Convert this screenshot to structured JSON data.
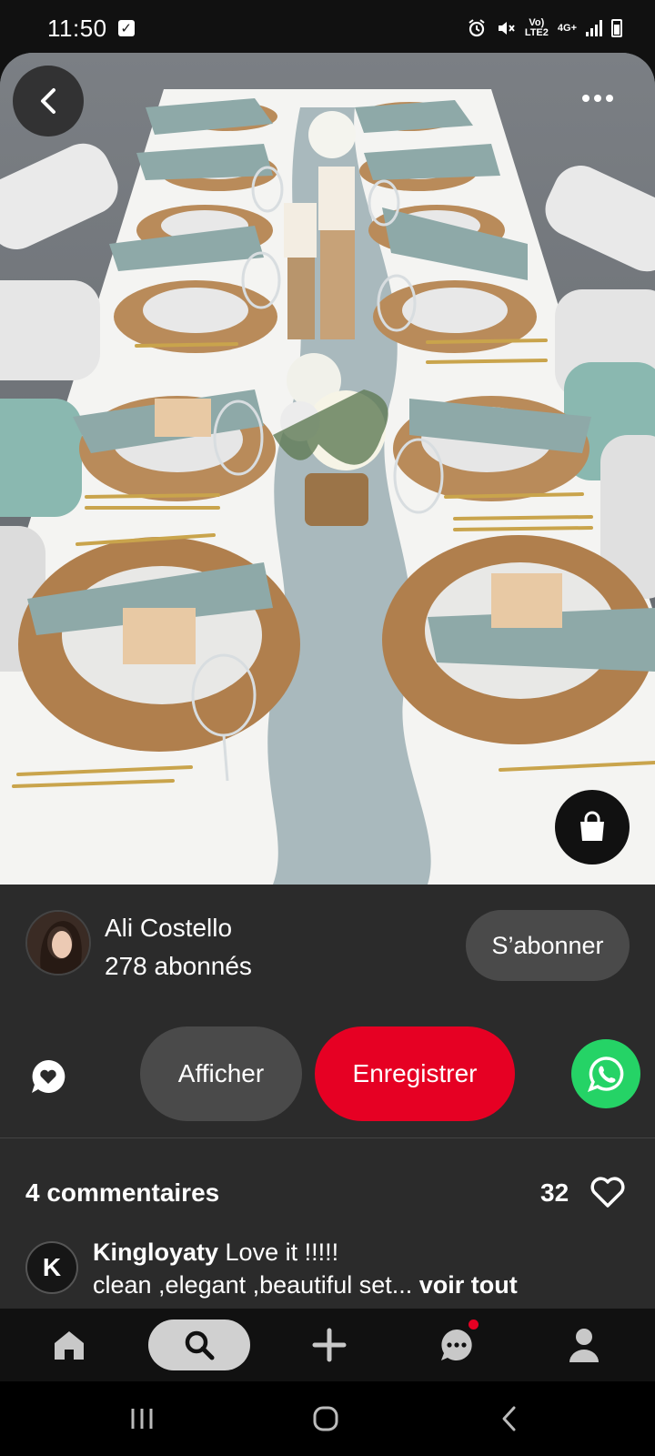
{
  "status_bar": {
    "time": "11:50",
    "network_top": "Vo)",
    "network_bottom": "LTE2",
    "network_type": "4G+",
    "icons": [
      "checkbox-icon",
      "alarm-icon",
      "mute-icon",
      "signal-icon",
      "battery-icon"
    ]
  },
  "pin": {
    "image_icons": [
      "back-arrow-icon",
      "more-dots-icon",
      "shopping-bag-icon"
    ]
  },
  "author": {
    "name": "Ali Costello",
    "followers": "278 abonnés",
    "follow_label": "S’abonner"
  },
  "actions": {
    "view_label": "Afficher",
    "save_label": "Enregistrer",
    "save_color": "#e60023",
    "whatsapp_color": "#25d366"
  },
  "comments": {
    "title": "4 commentaires",
    "likes": "32",
    "first": {
      "avatar_initial": "K",
      "user": "Kingloyaty",
      "text": " Love it !!!!!",
      "text2": "clean ,elegant ,beautiful set...",
      "see_all": " voir tout"
    }
  },
  "bottom_nav": {
    "items": [
      "home-icon",
      "search-icon",
      "plus-icon",
      "messages-icon",
      "profile-icon"
    ],
    "active": "search-icon"
  },
  "system_nav": [
    "recents-icon",
    "home-circle-icon",
    "back-chevron-icon"
  ]
}
